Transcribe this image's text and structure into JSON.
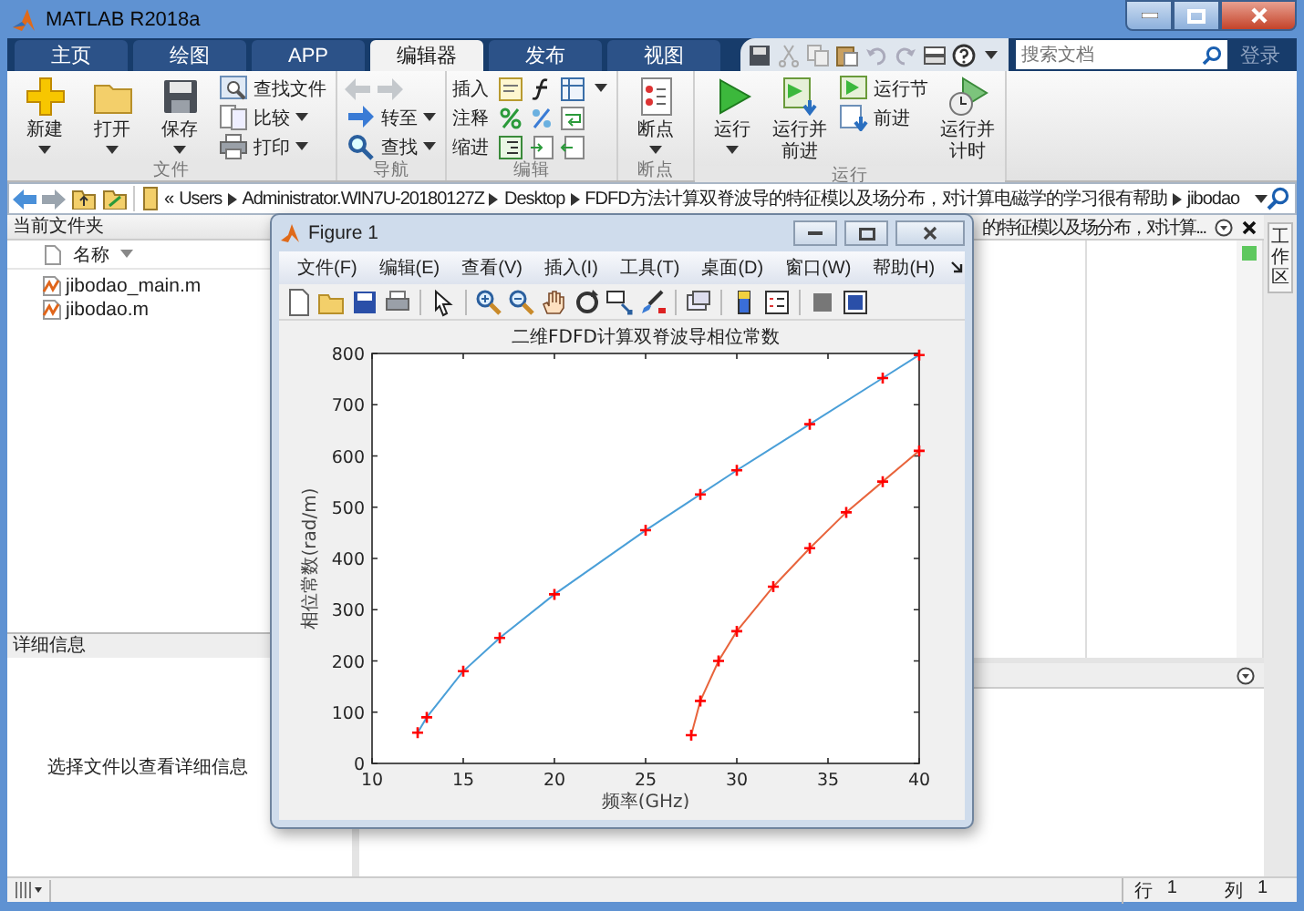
{
  "window": {
    "title": "MATLAB R2018a"
  },
  "tabs": [
    {
      "label": "主页",
      "selected": false
    },
    {
      "label": "绘图",
      "selected": false
    },
    {
      "label": "APP",
      "selected": false
    },
    {
      "label": "编辑器",
      "selected": true
    },
    {
      "label": "发布",
      "selected": false
    },
    {
      "label": "视图",
      "selected": false
    }
  ],
  "search": {
    "placeholder": "搜索文档"
  },
  "sign_in": "登录",
  "ribbon": {
    "groups": [
      {
        "title": "文件",
        "items": [
          {
            "kind": "large",
            "label": "新建",
            "dropdown": true
          },
          {
            "kind": "large",
            "label": "打开",
            "dropdown": true
          },
          {
            "kind": "large",
            "label": "保存",
            "dropdown": true
          },
          {
            "kind": "small",
            "label": "查找文件",
            "dropdown": false
          },
          {
            "kind": "small",
            "label": "比较",
            "dropdown": true
          },
          {
            "kind": "small",
            "label": "打印",
            "dropdown": true
          }
        ]
      },
      {
        "title": "导航",
        "items": [
          {
            "kind": "icon_pair",
            "disabled": true
          },
          {
            "kind": "small",
            "label": "转至",
            "dropdown": true
          },
          {
            "kind": "small",
            "label": "查找",
            "dropdown": true
          }
        ]
      },
      {
        "title": "编辑",
        "items": [
          {
            "kind": "icon_row",
            "label": "插入",
            "dropdown": true
          },
          {
            "kind": "icon_row",
            "label": "注释",
            "dropdown": false
          },
          {
            "kind": "icon_row",
            "label": "缩进",
            "dropdown": false
          }
        ]
      },
      {
        "title": "断点",
        "items": [
          {
            "kind": "large",
            "label": "断点",
            "dropdown": true
          }
        ]
      },
      {
        "title": "运行",
        "items": [
          {
            "kind": "large",
            "label": "运行",
            "dropdown": true
          },
          {
            "kind": "large",
            "label": "运行并前进",
            "dropdown": false
          },
          {
            "kind": "small",
            "label": "运行节",
            "dropdown": false
          },
          {
            "kind": "small",
            "label": "前进",
            "dropdown": false
          },
          {
            "kind": "large",
            "label": "运行并计时",
            "dropdown": false
          }
        ]
      }
    ]
  },
  "path_bar": {
    "overflow": "«",
    "crumbs": [
      "Users",
      "Administrator.WIN7U-20180127Z",
      "Desktop",
      "FDFD方法计算双脊波导的特征模以及场分布，对计算电磁学的学习很有帮助",
      "jibodao"
    ]
  },
  "current_folder": {
    "title": "当前文件夹",
    "column": "名称",
    "files": [
      {
        "name": "jibodao_main.m"
      },
      {
        "name": "jibodao.m"
      }
    ]
  },
  "details": {
    "title": "详细信息",
    "message": "选择文件以查看详细信息"
  },
  "editor": {
    "tab_title": "的特征模以及场分布，对计算..."
  },
  "workspace_tab": "工作区",
  "status_bar": {
    "row_label": "行",
    "row": "1",
    "col_label": "列",
    "col": "1"
  },
  "figure": {
    "title": "Figure 1",
    "menus": [
      "文件(F)",
      "编辑(E)",
      "查看(V)",
      "插入(I)",
      "工具(T)",
      "桌面(D)",
      "窗口(W)",
      "帮助(H)"
    ],
    "chart_data": {
      "type": "line",
      "title": "二维FDFD计算双脊波导相位常数",
      "xlabel": "频率(GHz)",
      "ylabel": "相位常数(rad/m)",
      "xlim": [
        10,
        40
      ],
      "ylim": [
        0,
        800
      ],
      "xticks": [
        10,
        15,
        20,
        25,
        30,
        35,
        40
      ],
      "yticks": [
        0,
        100,
        200,
        300,
        400,
        500,
        600,
        700,
        800
      ],
      "series": [
        {
          "color": "#4a9fd8",
          "marker": "+",
          "x": [
            12.5,
            13,
            15,
            17,
            20,
            25,
            28,
            30,
            34,
            38,
            40
          ],
          "values": [
            60,
            90,
            180,
            245,
            330,
            455,
            525,
            572,
            662,
            752,
            797
          ]
        },
        {
          "color": "#e8643c",
          "marker": "+",
          "x": [
            27.5,
            28,
            29,
            30,
            32,
            34,
            36,
            38,
            40
          ],
          "values": [
            55,
            122,
            200,
            258,
            345,
            420,
            490,
            550,
            610
          ]
        }
      ]
    }
  }
}
